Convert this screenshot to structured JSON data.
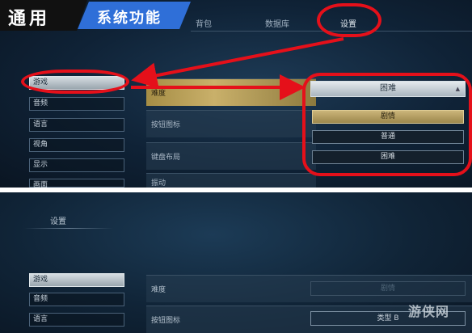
{
  "banner": {
    "left_text": "通用",
    "right_text": "系统功能"
  },
  "top_tabs": [
    "背包",
    "数据库",
    "设置"
  ],
  "menu": [
    "游戏",
    "音频",
    "语言",
    "视角",
    "显示",
    "画面"
  ],
  "settings_rows": [
    {
      "label": "难度"
    },
    {
      "label": "按钮图标"
    },
    {
      "label": "键盘布局"
    },
    {
      "label": "振动"
    }
  ],
  "dropdown": {
    "current": "困难",
    "options": [
      "剧情",
      "普通",
      "困难"
    ],
    "highlighted": "剧情"
  },
  "bottom": {
    "tab": "设置",
    "menu": [
      "游戏",
      "音频",
      "语言"
    ],
    "rows": [
      {
        "label": "难度",
        "value": "剧情"
      },
      {
        "label": "按钮图标",
        "value": "类型 B"
      }
    ]
  },
  "watermark": "游侠网",
  "colors": {
    "annotation_red": "#e5101a",
    "banner_blue": "#2f6fd8",
    "highlight_gold": "#c9b06a"
  }
}
